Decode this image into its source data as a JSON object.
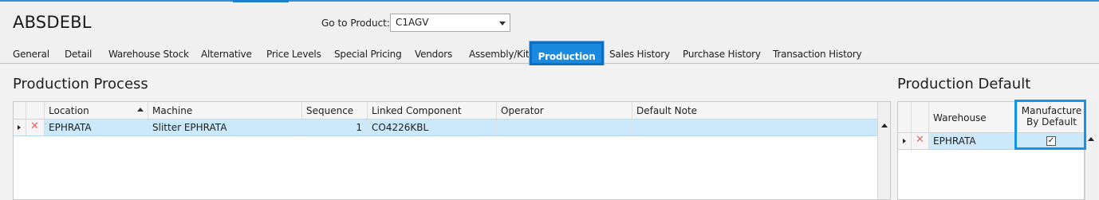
{
  "product_code": "ABSDEBL",
  "goto": {
    "label": "Go to Product:",
    "value": "C1AGV"
  },
  "tabs": [
    {
      "label": "General"
    },
    {
      "label": "Detail"
    },
    {
      "label": "Warehouse Stock"
    },
    {
      "label": "Alternative"
    },
    {
      "label": "Price Levels"
    },
    {
      "label": "Special Pricing"
    },
    {
      "label": "Vendors"
    },
    {
      "label": "Assembly/Kit"
    },
    {
      "label": "Production",
      "active": true
    },
    {
      "label": "Sales History"
    },
    {
      "label": "Purchase History"
    },
    {
      "label": "Transaction History"
    }
  ],
  "process": {
    "title": "Production Process",
    "columns": [
      "Location",
      "Machine",
      "Sequence",
      "Linked Component",
      "Operator",
      "Default Note"
    ],
    "sorted_column": "Location",
    "rows": [
      {
        "location": "EPHRATA",
        "machine": "Slitter EPHRATA",
        "sequence": "1",
        "linked_component": "CO4226KBL",
        "operator": "",
        "default_note": ""
      }
    ]
  },
  "default": {
    "title": "Production Default",
    "columns": [
      "Warehouse",
      "Manufacture",
      "By Default"
    ],
    "rows": [
      {
        "warehouse": "EPHRATA",
        "manufacture_by_default": "✓"
      }
    ]
  },
  "colors": {
    "accent": "#1a8ae0",
    "selected_row": "#cce8fb",
    "highlight": "#1593e6"
  },
  "icons": {
    "delete": "x-icon",
    "row_indicator": "arrow-right-icon",
    "sort": "sort-ascending-icon",
    "scroll": "scroll-up-icon",
    "dropdown": "chevron-down-icon"
  }
}
